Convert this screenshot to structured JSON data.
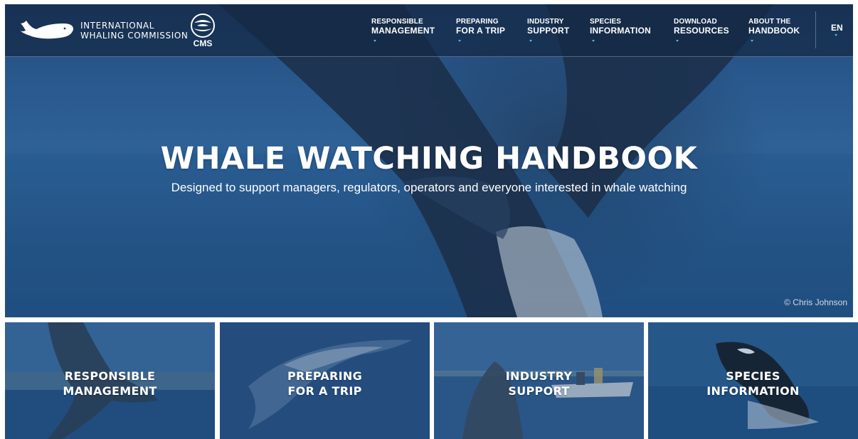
{
  "brand": {
    "line1": "INTERNATIONAL",
    "line2": "WHALING COMMISSION",
    "logo_icon": "whale-logo-icon",
    "partner_label": "CMS",
    "partner_icon": "cms-globe-icon"
  },
  "nav": {
    "items": [
      {
        "line1": "RESPONSIBLE",
        "line2": "MANAGEMENT"
      },
      {
        "line1": "PREPARING",
        "line2": "FOR A TRIP"
      },
      {
        "line1": "INDUSTRY",
        "line2": "SUPPORT"
      },
      {
        "line1": "SPECIES",
        "line2": "INFORMATION"
      },
      {
        "line1": "DOWNLOAD",
        "line2": "RESOURCES"
      },
      {
        "line1": "ABOUT THE",
        "line2": "HANDBOOK"
      }
    ],
    "language": "EN"
  },
  "hero": {
    "title": "WHALE WATCHING HANDBOOK",
    "subtitle": "Designed to support managers, regulators, operators and everyone interested in whale watching",
    "credit": "© Chris Johnson"
  },
  "tiles": [
    {
      "line1": "RESPONSIBLE",
      "line2": "MANAGEMENT"
    },
    {
      "line1": "PREPARING",
      "line2": "FOR A TRIP"
    },
    {
      "line1": "INDUSTRY",
      "line2": "SUPPORT"
    },
    {
      "line1": "SPECIES",
      "line2": "INFORMATION"
    }
  ],
  "colors": {
    "overlay": "#1f4a79",
    "accent_dot": "#4fb6ea",
    "text": "#ffffff"
  }
}
